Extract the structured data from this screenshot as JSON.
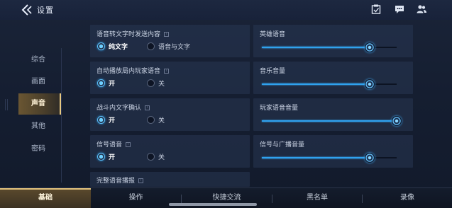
{
  "header": {
    "title": "设置",
    "icons": [
      "back-icon",
      "task-icon",
      "chat-icon",
      "friends-icon"
    ]
  },
  "sidebar": {
    "items": [
      {
        "label": "综合",
        "active": false
      },
      {
        "label": "画面",
        "active": false
      },
      {
        "label": "声音",
        "active": true
      },
      {
        "label": "其他",
        "active": false
      },
      {
        "label": "密码",
        "active": false
      }
    ]
  },
  "settings": {
    "speech_to_text": {
      "label": "语音转文字时发送内容",
      "options": [
        "纯文字",
        "语音与文字"
      ],
      "selected": "纯文字"
    },
    "auto_play_voice": {
      "label": "自动播放局内玩家语音",
      "options": [
        "开",
        "关"
      ],
      "selected": "开"
    },
    "battle_text_confirm": {
      "label": "战斗内文字确认",
      "options": [
        "开",
        "关"
      ],
      "selected": "开"
    },
    "signal_voice": {
      "label": "信号语音",
      "options": [
        "开",
        "关"
      ],
      "selected": "开"
    },
    "full_voice_broadcast": {
      "label": "完整语音播报"
    },
    "info_icon_glyph": "i"
  },
  "sliders": {
    "hero_voice": {
      "label": "英雄语音",
      "value": 0.8
    },
    "music_volume": {
      "label": "音乐音量",
      "value": 0.8
    },
    "player_voice_volume": {
      "label": "玩家语音音量",
      "value": 1.0
    },
    "signal_broadcast_volume": {
      "label": "信号与广播音量",
      "value": 0.8
    }
  },
  "bottom_tabs": [
    {
      "label": "基础",
      "active": true
    },
    {
      "label": "操作",
      "active": false
    },
    {
      "label": "快捷交流",
      "active": false
    },
    {
      "label": "黑名单",
      "active": false
    },
    {
      "label": "录像",
      "active": false
    }
  ],
  "colors": {
    "accent_blue": "#2fa2ef",
    "active_gold": "#e2c27c",
    "background": "#151e31"
  }
}
